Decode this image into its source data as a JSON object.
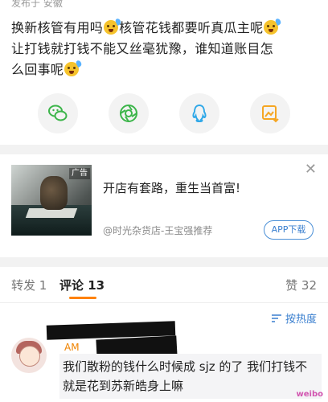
{
  "post": {
    "meta": "发布于 安徽",
    "line1a": "换新核管有用吗",
    "line1b": "核管花钱都要听真瓜主呢",
    "line2": "让打钱就打钱不能又丝毫犹豫，谁知道账目怎",
    "line3": "么回事呢"
  },
  "share": [
    {
      "icon": "wechat-icon"
    },
    {
      "icon": "moments-icon"
    },
    {
      "icon": "qq-icon"
    },
    {
      "icon": "save-image-icon"
    }
  ],
  "ad": {
    "tag": "广告",
    "title": "开店有套路，重生当首富!",
    "source": "@时光杂货店-王宝强推荐",
    "button": "APP下载",
    "close": "✕"
  },
  "tabs": {
    "repost": "转发 1",
    "comment": "评论 13",
    "like": "赞 32"
  },
  "sort": {
    "label": "按热度"
  },
  "comment": {
    "username_fragment": "AM",
    "text": "我们散粉的钱什么时候成 sjz 的了 我们打钱不就是花到苏新皓身上嘛"
  },
  "watermark": "weibo",
  "colors": {
    "accent": "#ff8200",
    "link": "#3a7fcf",
    "wechat": "#3cb54a",
    "qq": "#2fa8e8",
    "save": "#f5a623"
  }
}
